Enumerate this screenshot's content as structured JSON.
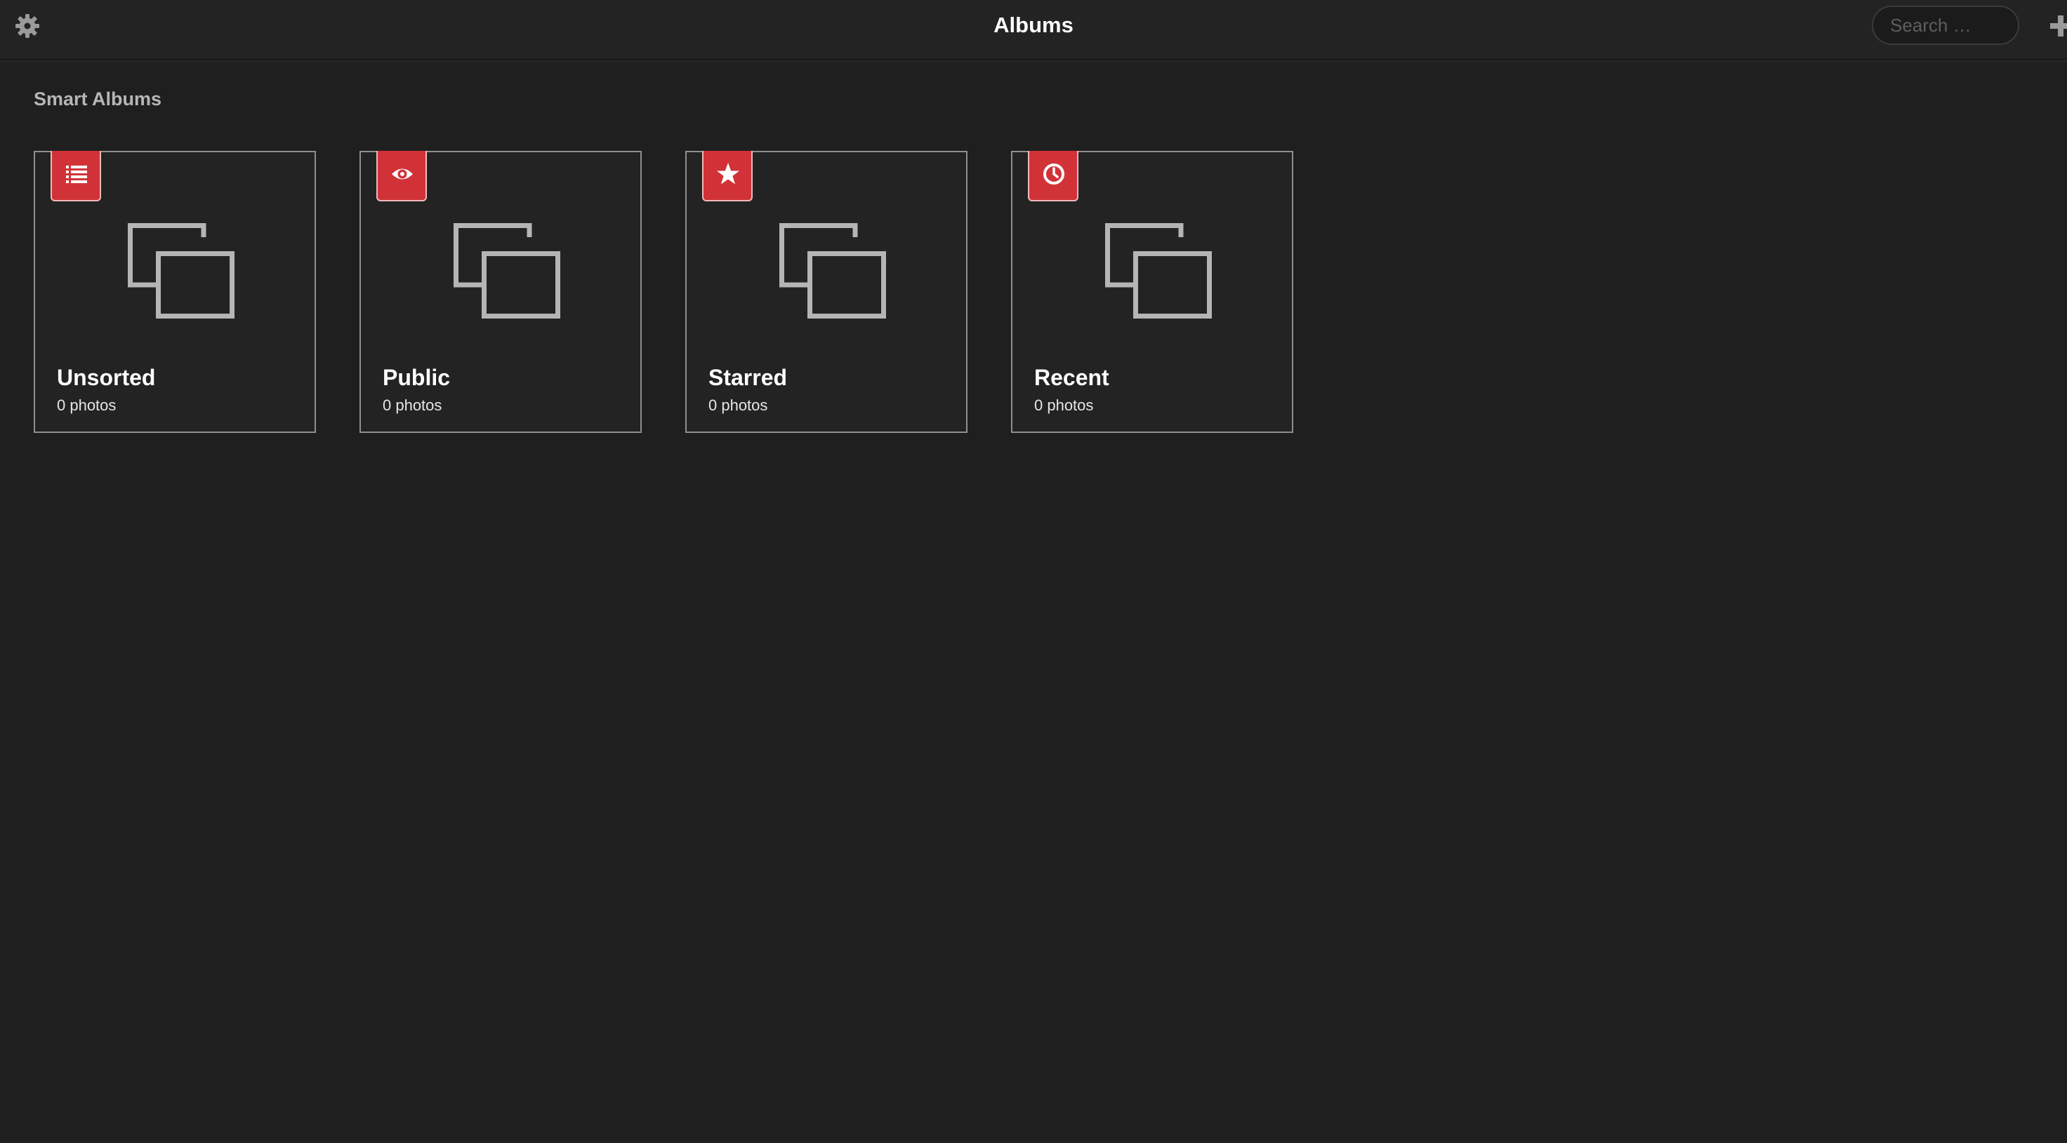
{
  "header": {
    "title": "Albums",
    "settings_icon": "gear-icon",
    "search_placeholder": "Search …",
    "search_value": "",
    "add_icon": "plus-icon"
  },
  "section": {
    "title": "Smart Albums"
  },
  "albums": [
    {
      "title": "Unsorted",
      "count": "0 photos",
      "badge_icon": "list-icon"
    },
    {
      "title": "Public",
      "count": "0 photos",
      "badge_icon": "eye-icon"
    },
    {
      "title": "Starred",
      "count": "0 photos",
      "badge_icon": "star-icon"
    },
    {
      "title": "Recent",
      "count": "0 photos",
      "badge_icon": "clock-icon"
    }
  ],
  "colors": {
    "background": "#1f1f1f",
    "header_background": "#232323",
    "badge": "#d13238",
    "card_border": "#8f8f8f",
    "placeholder_icon": "#b5b5b5"
  }
}
